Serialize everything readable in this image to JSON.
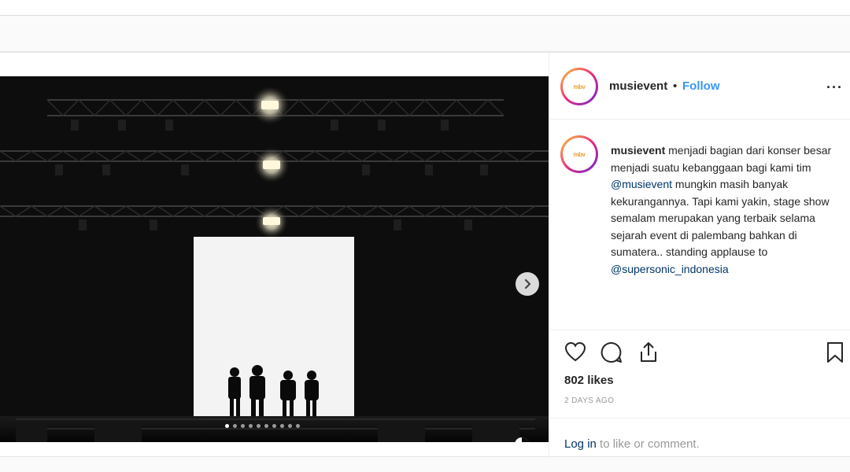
{
  "post": {
    "username": "musievent",
    "separator": "•",
    "follow_label": "Follow",
    "more_icon": "···",
    "avatar_text": "mbv",
    "caption": {
      "username": "musievent",
      "text_part1": " menjadi bagian dari konser besar menjadi suatu kebanggaan bagi kami tim ",
      "mention1": "@musievent",
      "text_part2": " mungkin masih banyak kekurangannya. Tapi kami yakin, stage show semalam merupakan yang terbaik selama sejarah event di palembang bahkan di sumatera.. standing applause to ",
      "mention2": "@supersonic_indonesia"
    },
    "likes": "802 likes",
    "time_ago": "2 DAYS AGO",
    "login_link": "Log in",
    "login_rest": " to like or comment."
  },
  "carousel": {
    "dot_count": 10,
    "active_index": 0
  },
  "colors": {
    "follow": "#3897f0",
    "mention": "#003569",
    "muted": "#999999"
  },
  "icons": {
    "like": "heart-icon",
    "comment": "comment-icon",
    "share": "share-icon",
    "save": "bookmark-icon",
    "next": "chevron-right-icon"
  }
}
